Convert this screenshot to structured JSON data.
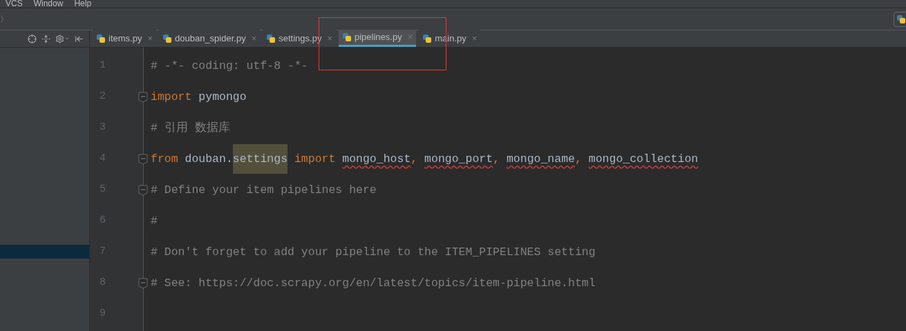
{
  "menu": [
    "VCS",
    "Window",
    "Help"
  ],
  "breadcrumb": {
    "separator": "〉"
  },
  "tabs": [
    {
      "label": "items.py",
      "selected": false,
      "close": "×"
    },
    {
      "label": "douban_spider.py",
      "selected": false,
      "close": "×"
    },
    {
      "label": "settings.py",
      "selected": false,
      "close": "×"
    },
    {
      "label": "pipelines.py",
      "selected": true,
      "close": "×"
    },
    {
      "label": "main.py",
      "selected": false,
      "close": "×"
    }
  ],
  "editor": {
    "lines": [
      {
        "number": "1",
        "fold": false,
        "tokens": [
          {
            "kind": "comment",
            "text": "# -*- coding: utf-8 -*-"
          }
        ]
      },
      {
        "number": "2",
        "fold": true,
        "tokens": [
          {
            "kind": "keyword",
            "text": "import"
          },
          {
            "kind": "plain",
            "text": " pymongo"
          }
        ]
      },
      {
        "number": "3",
        "fold": false,
        "tokens": [
          {
            "kind": "comment",
            "text": "# 引用 数据库"
          }
        ]
      },
      {
        "number": "4",
        "fold": true,
        "tokens": [
          {
            "kind": "keyword",
            "text": "from"
          },
          {
            "kind": "plain",
            "text": " douban."
          },
          {
            "kind": "highlight",
            "text": "settings"
          },
          {
            "kind": "keyword",
            "text": " import "
          },
          {
            "kind": "warning",
            "text": "mongo_host"
          },
          {
            "kind": "keyword",
            "text": ", "
          },
          {
            "kind": "warning",
            "text": "mongo_port"
          },
          {
            "kind": "keyword",
            "text": ", "
          },
          {
            "kind": "warning",
            "text": "mongo_name"
          },
          {
            "kind": "keyword",
            "text": ", "
          },
          {
            "kind": "warning",
            "text": "mongo_collection"
          }
        ]
      },
      {
        "number": "5",
        "fold": true,
        "tokens": [
          {
            "kind": "comment",
            "text": "# Define your item pipelines here"
          }
        ]
      },
      {
        "number": "6",
        "fold": false,
        "tokens": [
          {
            "kind": "comment",
            "text": "#"
          }
        ]
      },
      {
        "number": "7",
        "fold": false,
        "tokens": [
          {
            "kind": "comment",
            "text": "# Don't forget to add your pipeline to the ITEM_PIPELINES setting"
          }
        ]
      },
      {
        "number": "8",
        "fold": true,
        "tokens": [
          {
            "kind": "comment",
            "text": "# See: https://doc.scrapy.org/en/latest/topics/item-pipeline.html"
          }
        ]
      },
      {
        "number": "9",
        "fold": false
      }
    ]
  }
}
